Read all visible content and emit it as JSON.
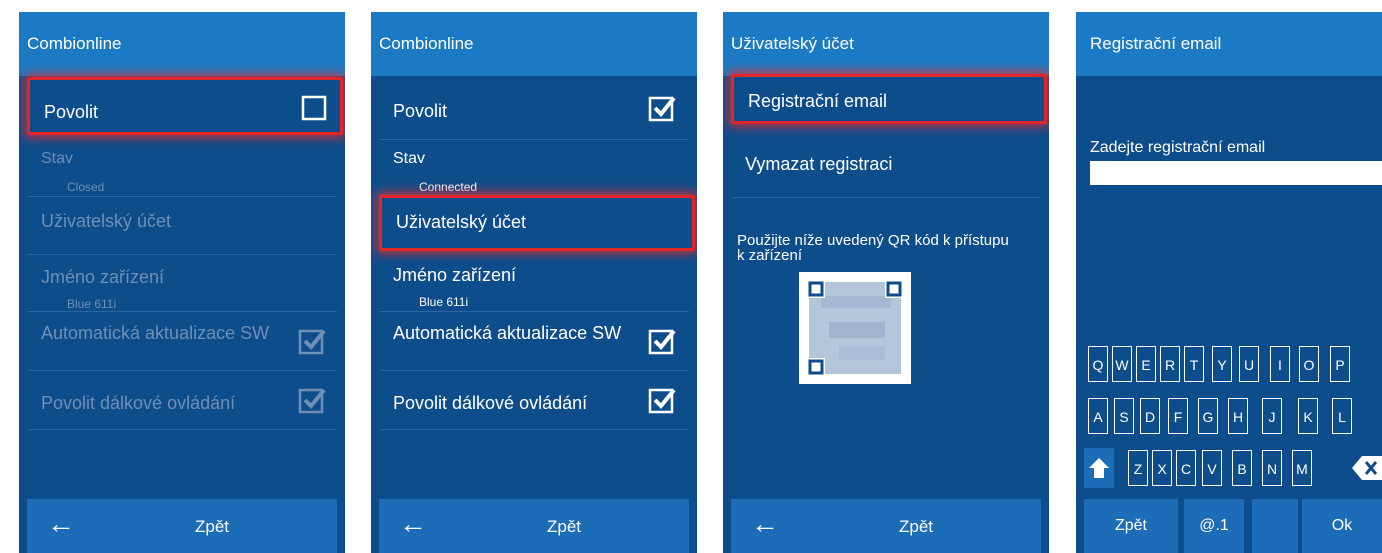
{
  "panel1": {
    "title": "Combionline",
    "rows": [
      {
        "label": "Povolit"
      },
      {
        "label": "Stav",
        "sub": "Closed"
      },
      {
        "label": "Uživatelský účet"
      },
      {
        "label": "Jméno zařízení",
        "sub": "Blue 611i"
      },
      {
        "label": "Automatická aktualizace SW",
        "checked": true
      },
      {
        "label": "Povolit dálkové ovládání",
        "checked": true
      }
    ],
    "enable_checked": false,
    "back_label": "Zpět"
  },
  "panel2": {
    "title": "Combionline",
    "rows": [
      {
        "label": "Povolit",
        "checked": true
      },
      {
        "label": "Stav",
        "sub": "Connected"
      },
      {
        "label": "Uživatelský účet"
      },
      {
        "label": "Jméno zařízení",
        "sub": "Blue 611i"
      },
      {
        "label": "Automatická aktualizace SW",
        "checked": true
      },
      {
        "label": "Povolit dálkové ovládání",
        "checked": true
      }
    ],
    "back_label": "Zpět"
  },
  "panel3": {
    "title": "Uživatelský účet",
    "rows": [
      {
        "label": "Registrační email"
      },
      {
        "label": "Vymazat registraci"
      }
    ],
    "qr_text": "Použijte níže uvedený QR kód k přístupu k zařízení",
    "back_label": "Zpět"
  },
  "panel4": {
    "title": "Registrační email",
    "email_label": "Zadejte registrační email",
    "email_value": "",
    "keyboard": {
      "row1": [
        "Q",
        "W",
        "E",
        "R",
        "T",
        "Y",
        "U",
        "I",
        "O",
        "P"
      ],
      "row2": [
        "A",
        "S",
        "D",
        "F",
        "G",
        "H",
        "J",
        "K",
        "L"
      ],
      "row3": [
        "Z",
        "X",
        "C",
        "V",
        "B",
        "N",
        "M"
      ],
      "back_label": "Zpět",
      "symbols_label": "@.1",
      "ok_label": "Ok"
    }
  },
  "colors": {
    "header": "#1c7ac4",
    "panel": "#0e4d8c",
    "highlight": "#e0262b",
    "disabled_text": "#6f8fb4"
  },
  "icons": [
    "checkbox-icon",
    "checkbox-checked-icon",
    "back-arrow-icon",
    "shift-icon",
    "backspace-icon",
    "qr-code-icon"
  ]
}
